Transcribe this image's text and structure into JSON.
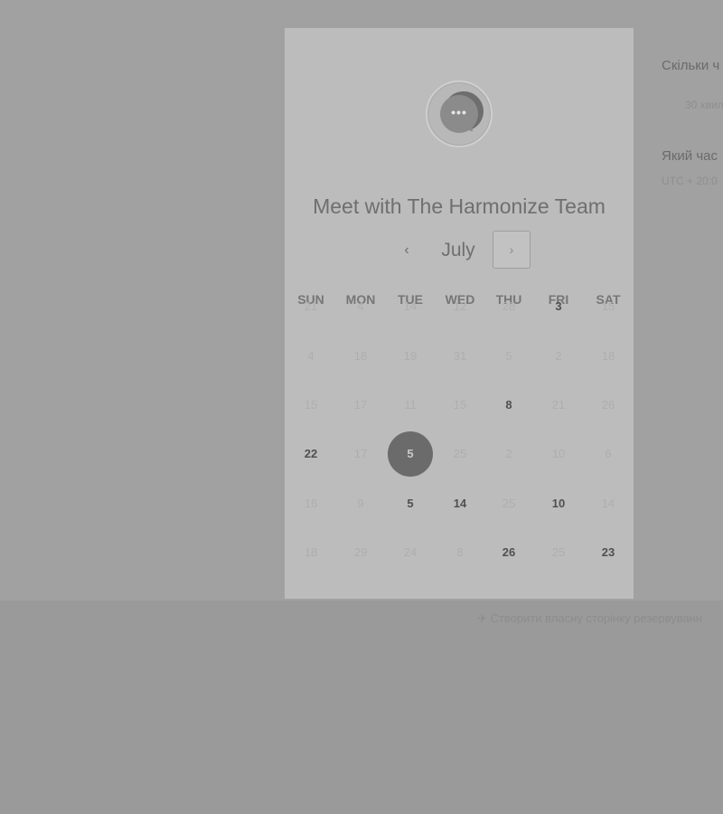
{
  "card": {
    "title": "Meet with The Harmonize Team",
    "logo_dots": "•••",
    "logo_icon": "chat-bubbles-icon"
  },
  "calendar": {
    "month": "July",
    "prev_icon": "‹",
    "next_icon": "›",
    "weekdays": [
      "SUN",
      "MON",
      "TUE",
      "WED",
      "THU",
      "FRI",
      "SAT"
    ],
    "weeks": [
      [
        "21",
        "4",
        "14",
        "12",
        "28",
        "3",
        "15"
      ],
      [
        "4",
        "18",
        "19",
        "31",
        "5",
        "2",
        "18"
      ],
      [
        "15",
        "17",
        "11",
        "15",
        "8",
        "21",
        "26"
      ],
      [
        "22",
        "17",
        "5",
        "25",
        "2",
        "10",
        "6"
      ],
      [
        "16",
        "9",
        "5",
        "14",
        "25",
        "10",
        "14"
      ],
      [
        "18",
        "29",
        "24",
        "8",
        "26",
        "25",
        "23"
      ]
    ],
    "available": [
      [
        0,
        5
      ],
      [
        2,
        4
      ],
      [
        3,
        0
      ],
      [
        4,
        2
      ],
      [
        4,
        3
      ],
      [
        4,
        5
      ],
      [
        5,
        4
      ],
      [
        5,
        6
      ]
    ],
    "selected": [
      3,
      2
    ]
  },
  "side": {
    "duration_question": "Скільки ч",
    "duration_value": "30 хвил",
    "time_question": "Який час",
    "timezone_value": "UTC + 20:0"
  },
  "footer": {
    "icon": "✈",
    "create_link": "Створити власну сторінку резервуванн"
  }
}
